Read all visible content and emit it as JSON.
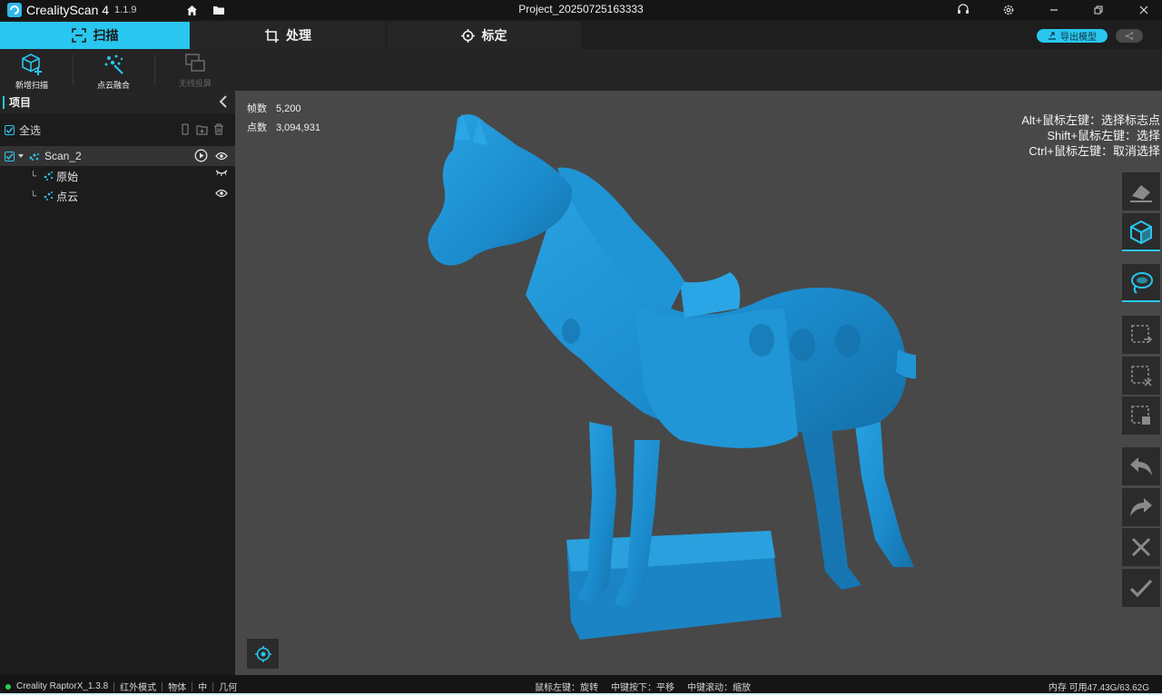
{
  "app": {
    "name": "CrealityScan 4",
    "version": "1.1.9",
    "project_title": "Project_20250725163333"
  },
  "tabs": [
    {
      "label": "扫描",
      "icon": "scan-frame-icon",
      "active": true
    },
    {
      "label": "处理",
      "icon": "crop-icon",
      "active": false
    },
    {
      "label": "标定",
      "icon": "crosshair-icon",
      "active": false
    }
  ],
  "export": {
    "label": "导出模型",
    "icon": "export-icon"
  },
  "toolbar": {
    "new_scan": "新增扫描",
    "point_cloud_fusion": "点云融合",
    "wireless_cast": "无线投屏"
  },
  "panel": {
    "title": "项目",
    "select_all": "全选",
    "items": [
      {
        "label": "Scan_2"
      },
      {
        "label": "原始"
      },
      {
        "label": "点云"
      }
    ]
  },
  "viewport": {
    "frames_label": "帧数",
    "frames_value": "5,200",
    "points_label": "点数",
    "points_value": "3,094,931",
    "hints": [
      "Alt+鼠标左键：选择标志点",
      "Shift+鼠标左键：选择",
      "Ctrl+鼠标左键：取消选择"
    ],
    "model_color": "#1e8fd0"
  },
  "statusbar": {
    "device": "Creality RaptorX_1.3.8",
    "mode": "红外模式",
    "object": "物体",
    "size": "中",
    "geometry": "几何",
    "left_btn": "鼠标左键：旋转",
    "middle_btn": "中键按下：平移",
    "scroll": "中键滚动：缩放",
    "memory": "内存 可用47.43G/63.62G"
  },
  "colors": {
    "accent": "#29c6ef",
    "viewport_bg": "#484848",
    "status_ok": "#2ecc52"
  }
}
